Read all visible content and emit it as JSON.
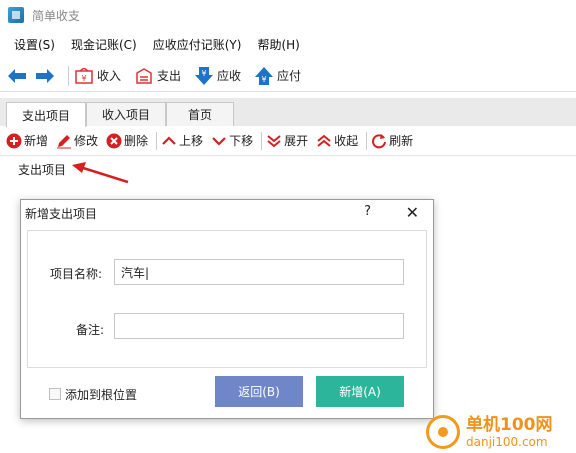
{
  "window": {
    "title": "简单收支"
  },
  "menu": [
    "设置(S)",
    "现金记账(C)",
    "应收应付记账(Y)",
    "帮助(H)"
  ],
  "toolbar": {
    "income": "收入",
    "expense": "支出",
    "receivable": "应收",
    "payable": "应付"
  },
  "tabs": [
    "支出项目",
    "收入项目",
    "首页"
  ],
  "subtoolbar": {
    "add": "新增",
    "edit": "修改",
    "delete": "删除",
    "move_up": "上移",
    "move_down": "下移",
    "expand": "展开",
    "collapse": "收起",
    "refresh": "刷新"
  },
  "tree": {
    "root": "支出项目"
  },
  "dialog": {
    "title": "新增支出项目",
    "help": "?",
    "close": "✕",
    "name_label": "项目名称:",
    "name_value": "汽车|",
    "note_label": "备注:",
    "note_value": "",
    "checkbox_label": "添加到根位置",
    "back_button": "返回(B)",
    "add_button": "新增(A)"
  },
  "watermark": {
    "line1": "单机100网",
    "line2": "danji100.com"
  },
  "colors": {
    "accent_blue": "#1e73c8",
    "back_button": "#6f87c9",
    "add_button": "#2db59b",
    "annotation_red": "#d81e1e"
  }
}
